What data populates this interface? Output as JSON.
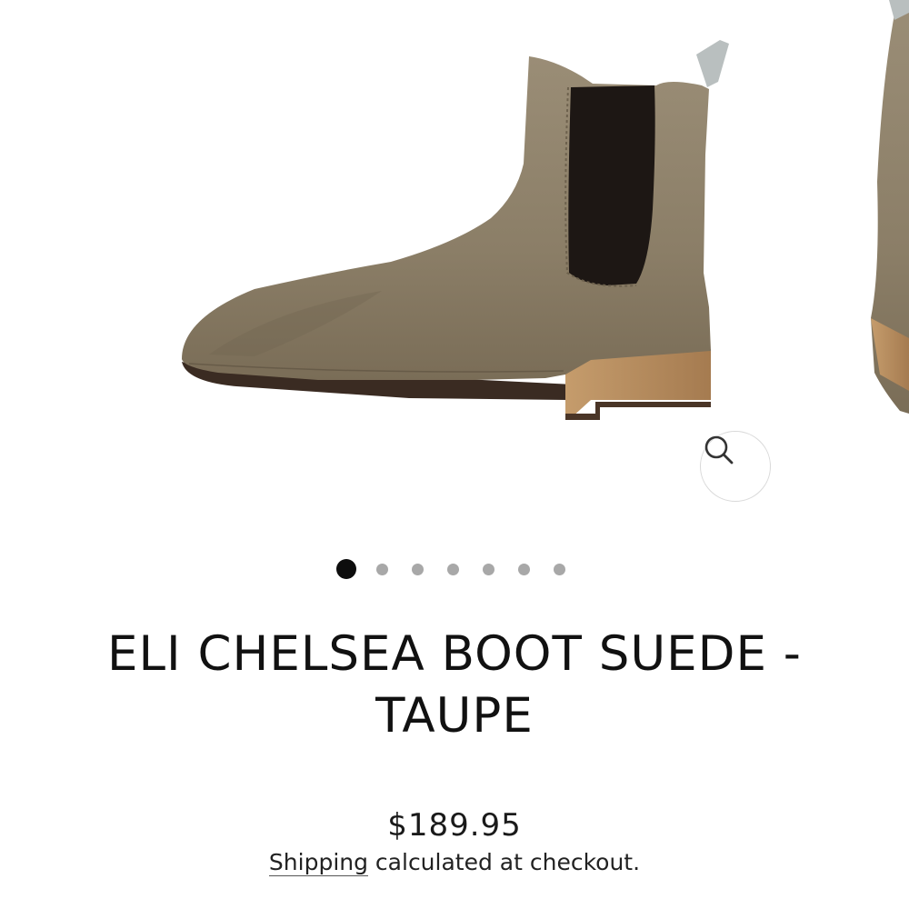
{
  "product": {
    "title": "ELI CHELSEA BOOT SUEDE - TAUPE",
    "price": "$189.95",
    "shipping_link": "Shipping",
    "shipping_text": " calculated at checkout."
  },
  "gallery": {
    "image_count": 7,
    "active_index": 0,
    "zoom_icon": "search-icon"
  },
  "colors": {
    "suede": "#8f826c",
    "elastic": "#1d1714",
    "heel": "#b48a5e",
    "active_dot": "#0d0d0d",
    "inactive_dot": "#a8a8a8"
  }
}
